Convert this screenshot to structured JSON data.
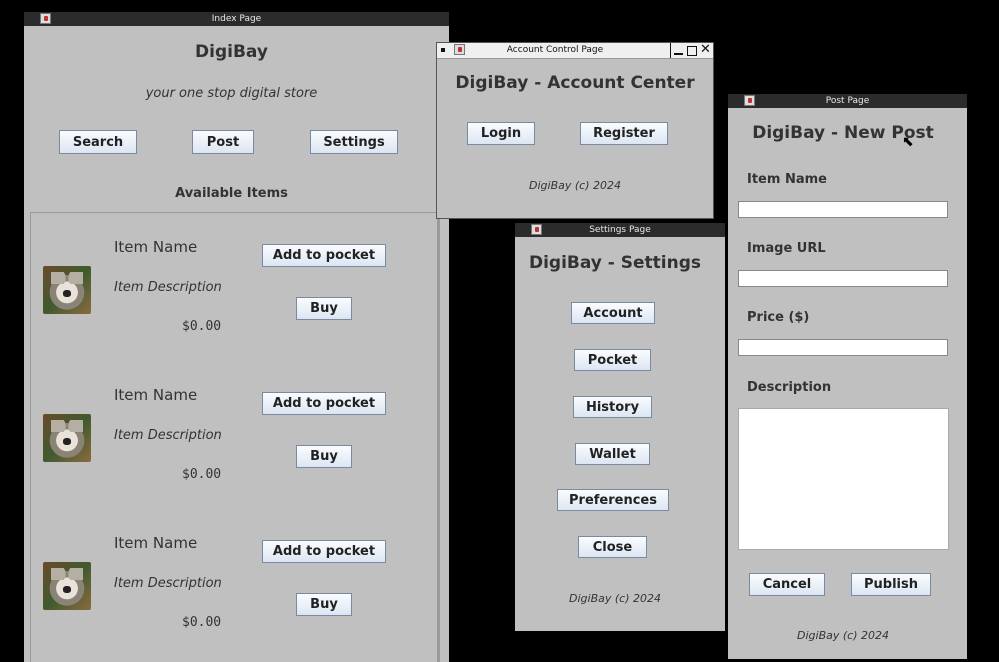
{
  "index": {
    "window_title": "Index Page",
    "app_title": "DigiBay",
    "tagline": "your one stop digital store",
    "nav": {
      "search": "Search",
      "post": "Post",
      "settings": "Settings"
    },
    "available_label": "Available Items",
    "items": [
      {
        "name": "Item Name",
        "description": "Item Description",
        "price": "$0.00",
        "add": "Add to pocket",
        "buy": "Buy"
      },
      {
        "name": "Item Name",
        "description": "Item Description",
        "price": "$0.00",
        "add": "Add to pocket",
        "buy": "Buy"
      },
      {
        "name": "Item Name",
        "description": "Item Description",
        "price": "$0.00",
        "add": "Add to pocket",
        "buy": "Buy"
      }
    ]
  },
  "account": {
    "window_title": "Account Control Page",
    "title": "DigiBay - Account Center",
    "login": "Login",
    "register": "Register",
    "footer": "DigiBay (c) 2024"
  },
  "settings": {
    "window_title": "Settings Page",
    "title": "DigiBay - Settings",
    "buttons": [
      "Account",
      "Pocket",
      "History",
      "Wallet",
      "Preferences",
      "Close"
    ],
    "footer": "DigiBay (c) 2024"
  },
  "post": {
    "window_title": "Post Page",
    "title": "DigiBay - New Post",
    "item_name_label": "Item Name",
    "item_name_value": "",
    "image_url_label": "Image URL",
    "image_url_value": "",
    "price_label": "Price ($)",
    "price_value": "",
    "description_label": "Description",
    "description_value": "",
    "cancel": "Cancel",
    "publish": "Publish",
    "footer": "DigiBay (c) 2024"
  },
  "colors": {
    "window_bg": "#c0c0c0",
    "desktop": "#000000",
    "titlebar": "#2b2b2b",
    "button_grad_top": "#fafcff",
    "button_grad_bottom": "#dce6f2"
  },
  "icons": [
    "java-app-icon",
    "minimize-icon",
    "maximize-icon",
    "close-icon",
    "mouse-pointer-icon",
    "koala-thumbnail"
  ]
}
